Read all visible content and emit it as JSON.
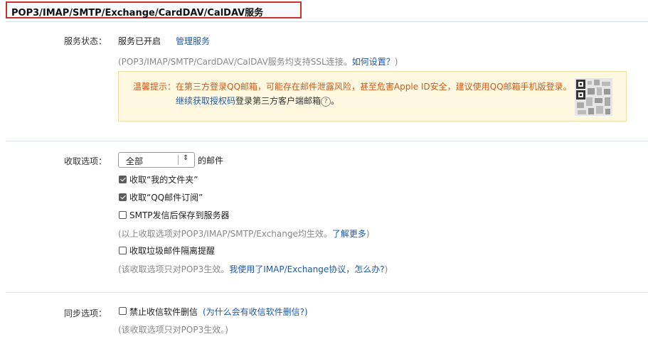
{
  "title": "POP3/IMAP/SMTP/Exchange/CardDAV/CalDAV服务",
  "service": {
    "label": "服务状态：",
    "status": "服务已开启",
    "manage": "管理服务",
    "note_prefix": "(POP3/IMAP/SMTP/CardDAV/CalDAV服务均支持SSL连接。",
    "note_link": "如何设置？",
    "note_suffix": ")"
  },
  "notice": {
    "label": "温馨提示：",
    "text": "在第三方登录QQ邮箱，可能存在邮件泄露风险，甚至危害Apple ID安全，建议使用QQ邮箱手机版登录。",
    "link": "继续获取授权码",
    "text2": "登录第三方客户端邮箱",
    "help": "?",
    "end": "。"
  },
  "receive": {
    "label": "收取选项：",
    "select_value": "全部",
    "select_suffix": "的邮件",
    "options": [
      {
        "label": "收取“我的文件夹”",
        "checked": true
      },
      {
        "label": "收取“QQ邮件订阅”",
        "checked": true
      },
      {
        "label": "SMTP发信后保存到服务器",
        "checked": false
      }
    ],
    "note1_prefix": "(以上收取选项对POP3/IMAP/SMTP/Exchange均生效。",
    "note1_link": "了解更多",
    "note1_suffix": ")",
    "spam": {
      "label": "收取垃圾邮件隔离提醒",
      "checked": false
    },
    "note2_prefix": "(该收取选项只对POP3生效。",
    "note2_link": "我使用了IMAP/Exchange协议，怎么办?",
    "note2_suffix": ")"
  },
  "sync": {
    "label": "同步选项：",
    "option": {
      "label": "禁止收信软件删信",
      "checked": false
    },
    "link": "(为什么会有收信软件删信?)",
    "note": "(该收取选项只对POP3生效。)"
  }
}
